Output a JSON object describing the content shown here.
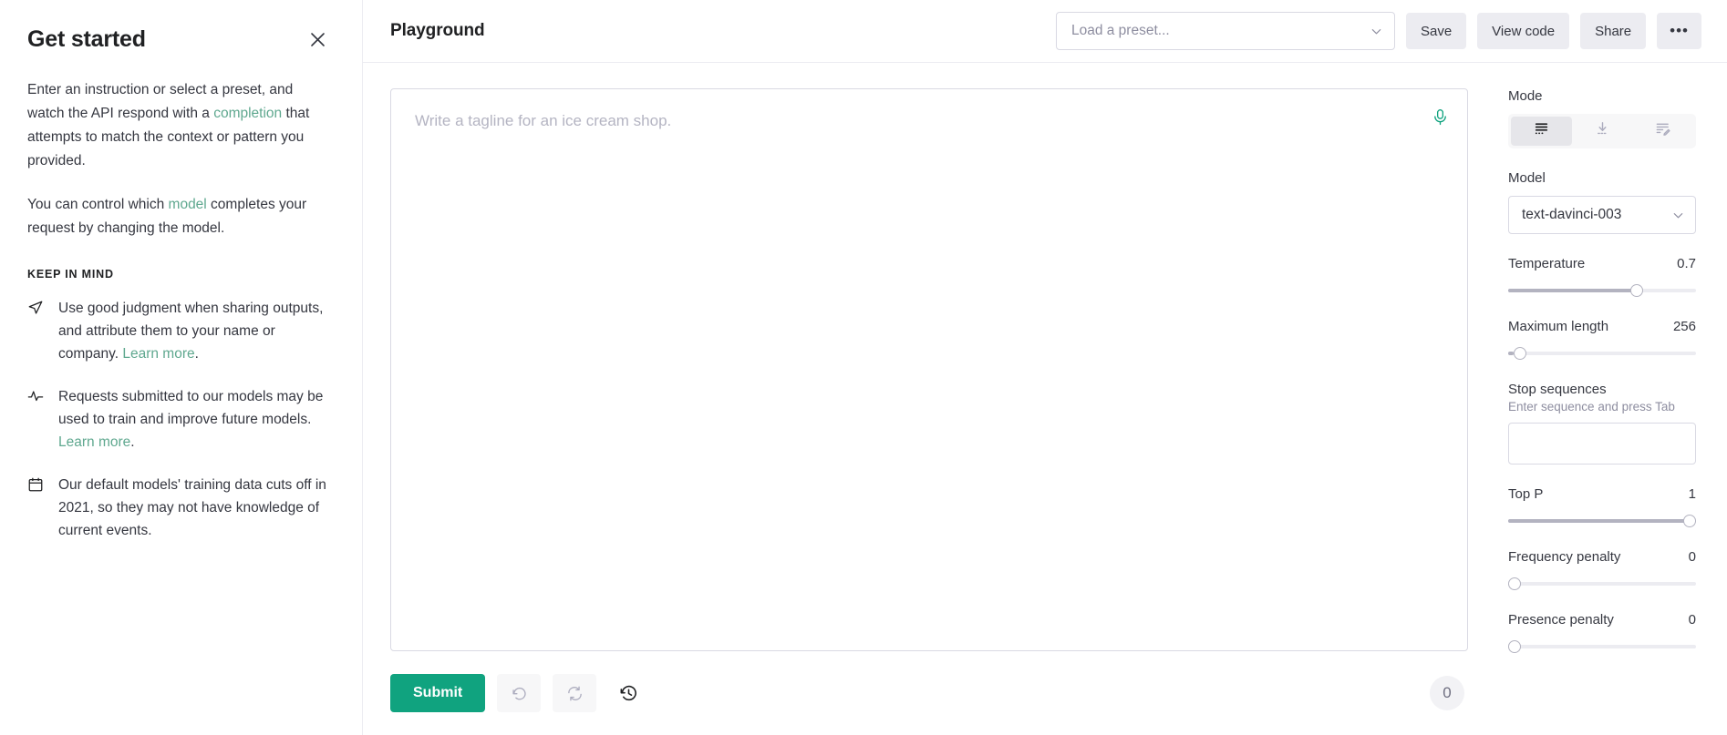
{
  "sidebar": {
    "title": "Get started",
    "close_icon": "close-icon",
    "paragraph1": {
      "part1": "Enter an instruction or select a preset, and watch the API respond with a ",
      "link": "completion",
      "part2": " that attempts to match the context or pattern you provided."
    },
    "paragraph2": {
      "part1": "You can control which ",
      "link": "model",
      "part2": " completes your request by changing the model."
    },
    "keep_in_mind_title": "KEEP IN MIND",
    "items": [
      {
        "icon": "send-icon",
        "text": "Use good judgment when sharing outputs, and attribute them to your name or company. ",
        "link": "Learn more",
        "suffix": "."
      },
      {
        "icon": "activity-icon",
        "text": "Requests submitted to our models may be used to train and improve future models. ",
        "link": "Learn more",
        "suffix": "."
      },
      {
        "icon": "calendar-icon",
        "text": "Our default models' training data cuts off in 2021, so they may not have knowledge of current events.",
        "link": "",
        "suffix": ""
      }
    ]
  },
  "topbar": {
    "title": "Playground",
    "preset_placeholder": "Load a preset...",
    "save_label": "Save",
    "view_code_label": "View code",
    "share_label": "Share",
    "more_label": "•••"
  },
  "editor": {
    "prompt_value": "",
    "prompt_placeholder": "Write a tagline for an ice cream shop.",
    "mic_icon": "microphone-icon",
    "submit_label": "Submit",
    "undo_icon": "undo-icon",
    "regenerate_icon": "refresh-icon",
    "history_icon": "history-icon",
    "token_count": "0"
  },
  "settings": {
    "mode_label": "Mode",
    "modes": [
      {
        "name": "complete",
        "icon": "complete-icon",
        "active": true
      },
      {
        "name": "insert",
        "icon": "insert-icon",
        "active": false
      },
      {
        "name": "edit",
        "icon": "edit-icon",
        "active": false
      }
    ],
    "model_label": "Model",
    "model_value": "text-davinci-003",
    "temperature_label": "Temperature",
    "temperature_value": "0.7",
    "temperature_pct": 70,
    "max_length_label": "Maximum length",
    "max_length_value": "256",
    "max_length_pct": 3,
    "stop_sequences_label": "Stop sequences",
    "stop_sequences_hint": "Enter sequence and press Tab",
    "stop_sequences_value": "",
    "top_p_label": "Top P",
    "top_p_value": "1",
    "top_p_pct": 100,
    "frequency_penalty_label": "Frequency penalty",
    "frequency_penalty_value": "0",
    "frequency_penalty_pct": 0,
    "presence_penalty_label": "Presence penalty",
    "presence_penalty_value": "0",
    "presence_penalty_pct": 0
  },
  "colors": {
    "accent": "#10a37f",
    "link": "#5fa88f",
    "text": "#353740",
    "border": "#d9d9e3"
  }
}
